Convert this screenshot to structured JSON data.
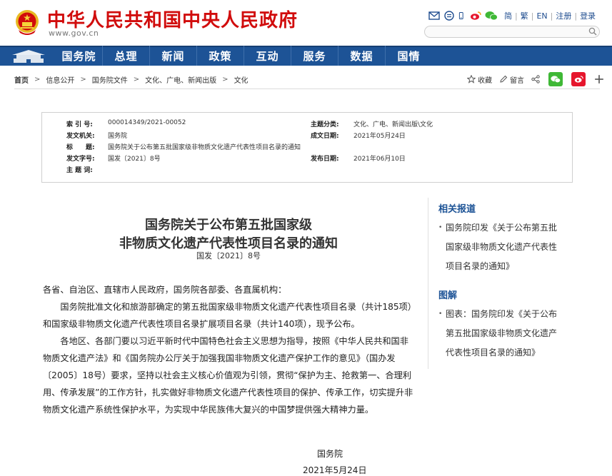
{
  "header": {
    "site_title": "中华人民共和国中央人民政府",
    "site_url": "www.gov.cn",
    "util_links": [
      "简",
      "繁",
      "EN",
      "注册",
      "登录"
    ],
    "search": {
      "value": ""
    }
  },
  "nav": {
    "items": [
      "国务院",
      "总理",
      "新闻",
      "政策",
      "互动",
      "服务",
      "数据",
      "国情"
    ]
  },
  "breadcrumb": {
    "items": [
      "首页",
      "信息公开",
      "国务院文件",
      "文化、广电、新闻出版",
      "文化"
    ]
  },
  "share": {
    "favorite": "收藏",
    "comment": "留言"
  },
  "meta": {
    "index_label": "索 引 号:",
    "index_value": "000014349/2021-00052",
    "category_label": "主题分类:",
    "category_value": "文化、广电、新闻出版\\文化",
    "issuer_label": "发文机关:",
    "issuer_value": "国务院",
    "created_label": "成文日期:",
    "created_value": "2021年05月24日",
    "title_label": "标　　题:",
    "title_value": "国务院关于公布第五批国家级非物质文化遗产代表性项目名录的通知",
    "docno_label": "发文字号:",
    "docno_value": "国发〔2021〕8号",
    "published_label": "发布日期:",
    "published_value": "2021年06月10日",
    "keywords_label": "主 题 词:",
    "keywords_value": ""
  },
  "article": {
    "title_line1": "国务院关于公布第五批国家级",
    "title_line2": "非物质文化遗产代表性项目名录的通知",
    "doc_no": "国发〔2021〕8号",
    "salutation": "各省、自治区、直辖市人民政府，国务院各部委、各直属机构：",
    "para1": "国务院批准文化和旅游部确定的第五批国家级非物质文化遗产代表性项目名录（共计185项）和国家级非物质文化遗产代表性项目名录扩展项目名录（共计140项），现予公布。",
    "para2": "各地区、各部门要以习近平新时代中国特色社会主义思想为指导，按照《中华人民共和国非物质文化遗产法》和《国务院办公厅关于加强我国非物质文化遗产保护工作的意见》（国办发〔2005〕18号）要求，坚持以社会主义核心价值观为引领，贯彻“保护为主、抢救第一、合理利用、传承发展”的工作方针，扎实做好非物质文化遗产代表性项目的保护、传承工作，切实提升非物质文化遗产系统性保护水平，为实现中华民族伟大复兴的中国梦提供强大精神力量。",
    "signature": "国务院",
    "date": "2021年5月24日"
  },
  "sidebar": {
    "related_title": "相关报道",
    "related_line1": "国务院印发《关于公布第五批",
    "related_line2": "国家级非物质文化遗产代表性",
    "related_line3": "项目名录的通知》",
    "chart_title": "图解",
    "chart_line1": "图表：国务院印发《关于公布",
    "chart_line2": "第五批国家级非物质文化遗产",
    "chart_line3": "代表性项目名录的通知》"
  },
  "colors": {
    "brand_red": "#d10c0c",
    "nav_blue": "#1d5396",
    "link_blue": "#1e4c8f",
    "wechat_green": "#3fb836",
    "weibo_red": "#e6162d"
  }
}
